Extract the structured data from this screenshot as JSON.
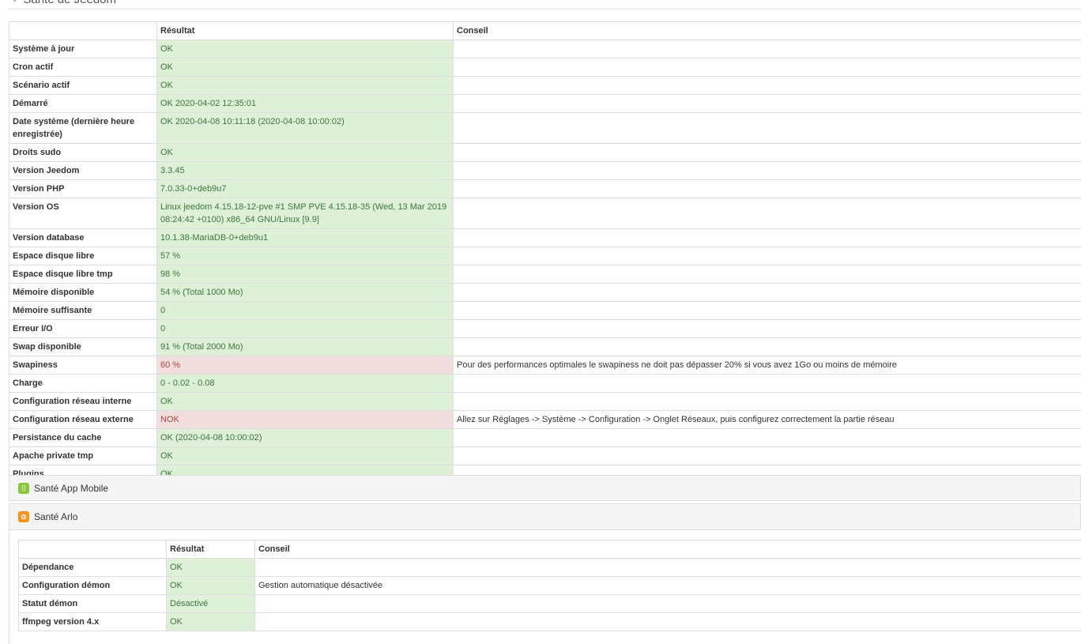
{
  "page": {
    "title": "Santé de Jeedom",
    "title_icon": "stethoscope-icon"
  },
  "main_table": {
    "headers": [
      "",
      "Résultat",
      "Conseil"
    ],
    "rows": [
      {
        "label": "Système à jour",
        "result": "OK",
        "advice": "",
        "status": "ok"
      },
      {
        "label": "Cron actif",
        "result": "OK",
        "advice": "",
        "status": "ok"
      },
      {
        "label": "Scénario actif",
        "result": "OK",
        "advice": "",
        "status": "ok"
      },
      {
        "label": "Démarré",
        "result": "OK 2020-04-02 12:35:01",
        "advice": "",
        "status": "ok"
      },
      {
        "label": "Date système (dernière heure enregistrée)",
        "result": "OK 2020-04-08 10:11:18 (2020-04-08 10:00:02)",
        "advice": "",
        "status": "ok"
      },
      {
        "label": "Droits sudo",
        "result": "OK",
        "advice": "",
        "status": "ok"
      },
      {
        "label": "Version Jeedom",
        "result": "3.3.45",
        "advice": "",
        "status": "ok"
      },
      {
        "label": "Version PHP",
        "result": "7.0.33-0+deb9u7",
        "advice": "",
        "status": "ok"
      },
      {
        "label": "Version OS",
        "result": "Linux jeedom 4.15.18-12-pve #1 SMP PVE 4.15.18-35 (Wed, 13 Mar 2019 08:24:42 +0100) x86_64 GNU/Linux [9.9]",
        "advice": "",
        "status": "ok"
      },
      {
        "label": "Version database",
        "result": "10.1.38-MariaDB-0+deb9u1",
        "advice": "",
        "status": "ok"
      },
      {
        "label": "Espace disque libre",
        "result": "57 %",
        "advice": "",
        "status": "ok"
      },
      {
        "label": "Espace disque libre tmp",
        "result": "98 %",
        "advice": "",
        "status": "ok"
      },
      {
        "label": "Mémoire disponible",
        "result": "54 % (Total 1000 Mo)",
        "advice": "",
        "status": "ok"
      },
      {
        "label": "Mémoire suffisante",
        "result": "0",
        "advice": "",
        "status": "ok"
      },
      {
        "label": "Erreur I/O",
        "result": "0",
        "advice": "",
        "status": "ok"
      },
      {
        "label": "Swap disponible",
        "result": "91 % (Total 2000 Mo)",
        "advice": "",
        "status": "ok"
      },
      {
        "label": "Swapiness",
        "result": "60 %",
        "advice": "Pour des performances optimales le swapiness ne doit pas dépasser 20% si vous avez 1Go ou moins de mémoire",
        "status": "nok"
      },
      {
        "label": "Charge",
        "result": "0 - 0.02 - 0.08",
        "advice": "",
        "status": "ok"
      },
      {
        "label": "Configuration réseau interne",
        "result": "OK",
        "advice": "",
        "status": "ok"
      },
      {
        "label": "Configuration réseau externe",
        "result": "NOK",
        "advice": "Allez sur Réglages -> Système -> Configuration -> Onglet Réseaux, puis configurez correctement la partie réseau",
        "status": "nok"
      },
      {
        "label": "Persistance du cache",
        "result": "OK (2020-04-08 10:00:02)",
        "advice": "",
        "status": "ok"
      },
      {
        "label": "Apache private tmp",
        "result": "OK",
        "advice": "",
        "status": "ok"
      },
      {
        "label": "Plugins",
        "result": "OK",
        "advice": "",
        "status": "ok"
      }
    ]
  },
  "panels": {
    "mobile": {
      "title": "Santé App Mobile",
      "icon": "mobile-app-icon"
    },
    "arlo": {
      "title": "Santé Arlo",
      "icon": "arlo-icon"
    }
  },
  "arlo_table": {
    "headers": [
      "",
      "Résultat",
      "Conseil"
    ],
    "rows": [
      {
        "label": "Dépendance",
        "result": "OK",
        "advice": "",
        "status": "ok"
      },
      {
        "label": "Configuration démon",
        "result": "OK",
        "advice": "Gestion automatique désactivée",
        "status": "ok"
      },
      {
        "label": "Statut démon",
        "result": "Désactivé",
        "advice": "",
        "status": "ok"
      },
      {
        "label": "ffmpeg version 4.x",
        "result": "OK",
        "advice": "",
        "status": "ok"
      }
    ]
  },
  "colors": {
    "ok_bg": "#dff0d8",
    "ok_text": "#3c763d",
    "nok_bg": "#f2dede",
    "nok_text": "#a94442"
  }
}
